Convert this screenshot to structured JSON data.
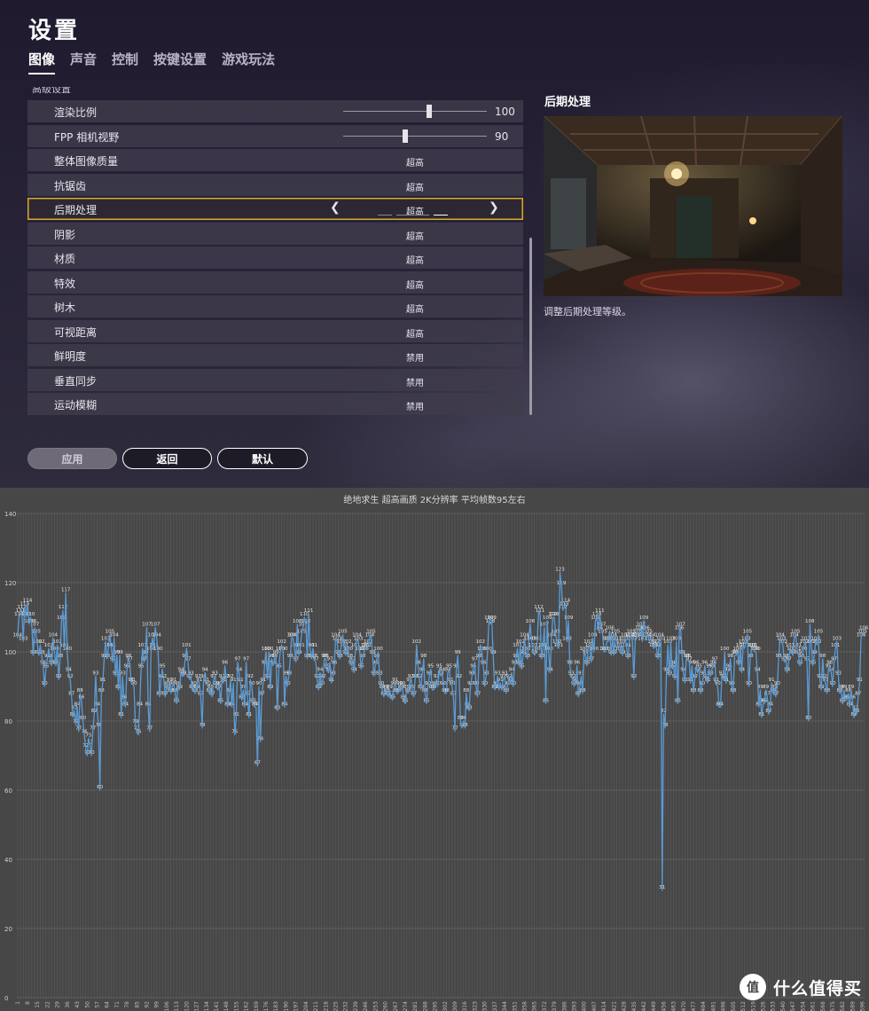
{
  "settings": {
    "title": "设置",
    "tabs": [
      {
        "label": "图像",
        "active": true
      },
      {
        "label": "声音",
        "active": false
      },
      {
        "label": "控制",
        "active": false
      },
      {
        "label": "按键设置",
        "active": false
      },
      {
        "label": "游戏玩法",
        "active": false
      }
    ],
    "section_cutoff": "高级设置",
    "rows": [
      {
        "label": "渲染比例",
        "type": "slider",
        "value": "100",
        "level": 0.6
      },
      {
        "label": "FPP 相机视野",
        "type": "slider",
        "value": "90",
        "level": 0.43
      },
      {
        "label": "整体图像质量",
        "type": "option",
        "value": "超高"
      },
      {
        "label": "抗锯齿",
        "type": "option",
        "value": "超高"
      },
      {
        "label": "后期处理",
        "type": "selector",
        "value": "超高",
        "level_index": 3,
        "level_count": 4
      },
      {
        "label": "阴影",
        "type": "option",
        "value": "超高"
      },
      {
        "label": "材质",
        "type": "option",
        "value": "超高"
      },
      {
        "label": "特效",
        "type": "option",
        "value": "超高"
      },
      {
        "label": "树木",
        "type": "option",
        "value": "超高"
      },
      {
        "label": "可视距离",
        "type": "option",
        "value": "超高"
      },
      {
        "label": "鲜明度",
        "type": "option",
        "value": "禁用"
      },
      {
        "label": "垂直同步",
        "type": "option",
        "value": "禁用"
      },
      {
        "label": "运动模糊",
        "type": "option",
        "value": "禁用"
      }
    ],
    "buttons": {
      "apply": "应用",
      "back": "返回",
      "default": "默认"
    },
    "preview": {
      "title": "后期处理",
      "description": "调整后期处理等级。"
    }
  },
  "chart_data": {
    "type": "line",
    "title": "绝地求生 超高画质 2K分辨率 平均帧数95左右",
    "xlabel": "",
    "ylabel": "",
    "ylim": [
      0,
      140
    ],
    "yticks": [
      0,
      20,
      40,
      60,
      80,
      100,
      120,
      140
    ],
    "x_start": 1,
    "x_step": 1,
    "x_tick_every": 7,
    "grid": true,
    "color": "#5b9bd5",
    "values": [
      104,
      110,
      111,
      112,
      103,
      113,
      110,
      114,
      108,
      110,
      108,
      99,
      107,
      105,
      102,
      99,
      102,
      99,
      96,
      90,
      95,
      98,
      101,
      98,
      96,
      104,
      100,
      96,
      102,
      92,
      98,
      109,
      112,
      101,
      117,
      100,
      94,
      92,
      87,
      81,
      83,
      79,
      84,
      77,
      88,
      86,
      80,
      76,
      72,
      70,
      75,
      73,
      70,
      77,
      82,
      93,
      84,
      78,
      60,
      88,
      91,
      98,
      103,
      98,
      101,
      105,
      101,
      97,
      104,
      93,
      99,
      89,
      99,
      81,
      93,
      86,
      84,
      95,
      98,
      97,
      91,
      91,
      90,
      79,
      77,
      76,
      84,
      95,
      101,
      97,
      99,
      107,
      84,
      77,
      100,
      104,
      101,
      107,
      104,
      100,
      87,
      92,
      95,
      92,
      87,
      90,
      89,
      91,
      88,
      90,
      91,
      88,
      85,
      90,
      89,
      94,
      93,
      93,
      98,
      101,
      97,
      92,
      93,
      89,
      90,
      88,
      89,
      92,
      91,
      87,
      78,
      92,
      94,
      91,
      90,
      88,
      89,
      87,
      92,
      93,
      90,
      89,
      90,
      85,
      92,
      91,
      96,
      92,
      84,
      88,
      92,
      84,
      91,
      76,
      81,
      97,
      94,
      91,
      86,
      89,
      84,
      97,
      87,
      81,
      92,
      90,
      85,
      84,
      84,
      67,
      90,
      74,
      87,
      91,
      96,
      100,
      92,
      100,
      89,
      98,
      96,
      98,
      99,
      83,
      95,
      100,
      102,
      100,
      84,
      93,
      90,
      93,
      98,
      104,
      104,
      101,
      97,
      108,
      99,
      101,
      105,
      107,
      110,
      108,
      98,
      111,
      101,
      98,
      101,
      98,
      97,
      92,
      89,
      94,
      90,
      92,
      98,
      98,
      95,
      94,
      97,
      91,
      93,
      96,
      104,
      103,
      99,
      98,
      102,
      105,
      101,
      99,
      102,
      100,
      98,
      96,
      97,
      94,
      101,
      104,
      103,
      100,
      95,
      98,
      100,
      101,
      101,
      102,
      104,
      105,
      99,
      93,
      96,
      98,
      100,
      93,
      90,
      89,
      87,
      89,
      88,
      87,
      89,
      87,
      86,
      90,
      91,
      88,
      88,
      90,
      89,
      90,
      86,
      85,
      89,
      88,
      91,
      92,
      89,
      87,
      92,
      102,
      96,
      92,
      89,
      94,
      98,
      88,
      85,
      90,
      93,
      95,
      89,
      89,
      90,
      92,
      90,
      95,
      93,
      94,
      90,
      88,
      88,
      94,
      95,
      91,
      90,
      87,
      77,
      95,
      99,
      92,
      80,
      78,
      80,
      78,
      88,
      84,
      83,
      90,
      93,
      95,
      97,
      90,
      87,
      98,
      102,
      100,
      96,
      90,
      93,
      100,
      109,
      108,
      109,
      99,
      89,
      90,
      93,
      89,
      91,
      89,
      92,
      93,
      88,
      90,
      92,
      91,
      94,
      90,
      96,
      98,
      101,
      96,
      102,
      95,
      99,
      104,
      100,
      98,
      103,
      108,
      103,
      101,
      99,
      100,
      103,
      112,
      111,
      98,
      101,
      107,
      85,
      109,
      100,
      94,
      104,
      110,
      110,
      105,
      102,
      101,
      123,
      119,
      112,
      113,
      114,
      103,
      109,
      96,
      93,
      92,
      90,
      91,
      96,
      87,
      90,
      93,
      88,
      100,
      99,
      96,
      102,
      101,
      97,
      104,
      100,
      109,
      110,
      106,
      111,
      107,
      105,
      100,
      100,
      103,
      103,
      106,
      99,
      104,
      99,
      105,
      103,
      101,
      100,
      102,
      99,
      103,
      104,
      101,
      98,
      104,
      105,
      103,
      92,
      104,
      104,
      105,
      106,
      107,
      103,
      109,
      106,
      104,
      105,
      103,
      104,
      102,
      101,
      102,
      101,
      98,
      104,
      103,
      31,
      82,
      78,
      94,
      102,
      93,
      103,
      95,
      96,
      92,
      103,
      85,
      106,
      107,
      99,
      94,
      91,
      98,
      98,
      97,
      91,
      96,
      88,
      92,
      96,
      94,
      95,
      88,
      90,
      93,
      96,
      92,
      91,
      95,
      93,
      95,
      96,
      97,
      91,
      90,
      84,
      84,
      93,
      92,
      100,
      91,
      94,
      95,
      98,
      90,
      88,
      99,
      99,
      100,
      96,
      101,
      94,
      102,
      101,
      103,
      105,
      90,
      98,
      101,
      101,
      100,
      100,
      94,
      84,
      89,
      81,
      85,
      85,
      89,
      87,
      82,
      84,
      91,
      88,
      89,
      87,
      90,
      98,
      104,
      103,
      102,
      97,
      98,
      94,
      97,
      101,
      100,
      99,
      104,
      105,
      101,
      99,
      96,
      98,
      100,
      102,
      103,
      97,
      80,
      108,
      102,
      96,
      99,
      103,
      102,
      105,
      92,
      89,
      98,
      92,
      91,
      88,
      95,
      96,
      94,
      90,
      97,
      101,
      103,
      93,
      88,
      89,
      85,
      89,
      86,
      86,
      88,
      84,
      89,
      86,
      81,
      83,
      82,
      87,
      91,
      104,
      105,
      106
    ]
  }
}
